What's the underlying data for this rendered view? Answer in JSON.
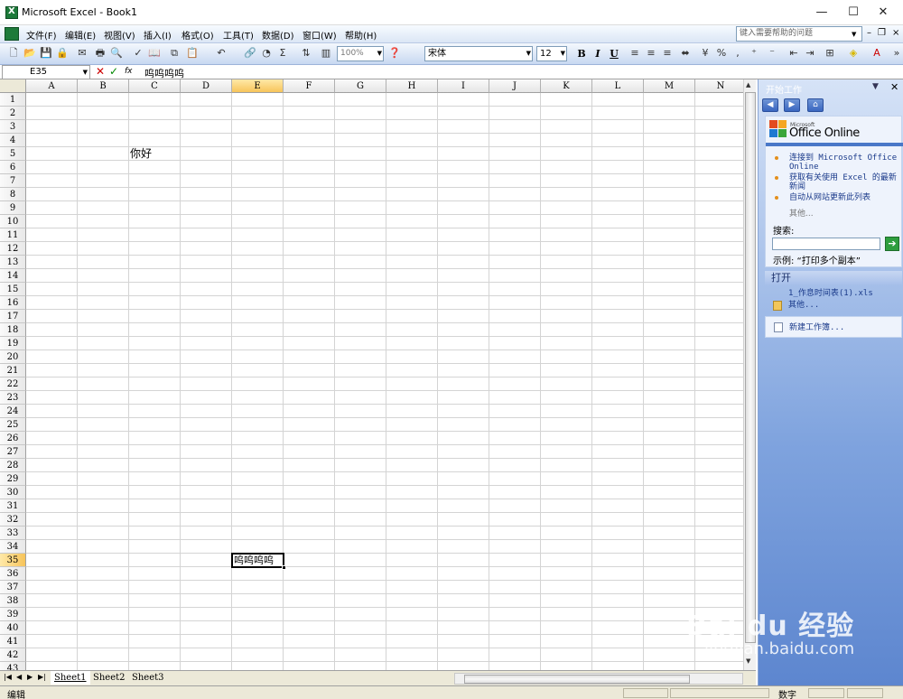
{
  "window": {
    "title": "Microsoft Excel - Book1",
    "minimize": "—",
    "maximize": "☐",
    "close": "✕"
  },
  "menubar": {
    "items": [
      "文件(F)",
      "编辑(E)",
      "视图(V)",
      "插入(I)",
      "格式(O)",
      "工具(T)",
      "数据(D)",
      "窗口(W)",
      "帮助(H)"
    ],
    "help_placeholder": "键入需要帮助的问题",
    "mdi_minimize": "–",
    "mdi_restore": "❐",
    "mdi_close": "×"
  },
  "toolbar": {
    "zoom": "100%",
    "font": "宋体",
    "font_size": "12",
    "bold": "B",
    "italic": "I",
    "underline": "U"
  },
  "formula_bar": {
    "name_box": "E35",
    "fx": "fx",
    "content": "呜呜呜呜"
  },
  "sheet": {
    "columns": [
      "A",
      "B",
      "C",
      "D",
      "E",
      "F",
      "G",
      "H",
      "I",
      "J",
      "K",
      "L",
      "M",
      "N"
    ],
    "active_column": "E",
    "rows": [
      "1",
      "2",
      "3",
      "4",
      "5",
      "6",
      "7",
      "8",
      "9",
      "10",
      "11",
      "12",
      "13",
      "14",
      "15",
      "16",
      "17",
      "18",
      "19",
      "20",
      "21",
      "22",
      "23",
      "24",
      "25",
      "26",
      "27",
      "28",
      "29",
      "30",
      "31",
      "32",
      "33",
      "34",
      "35",
      "36",
      "37",
      "38",
      "39",
      "40",
      "41",
      "42",
      "43"
    ],
    "active_row": "35",
    "cells": {
      "C5": "你好",
      "E35": "呜呜呜呜"
    }
  },
  "tabs": {
    "sheets": [
      "Sheet1",
      "Sheet2",
      "Sheet3"
    ],
    "active": "Sheet1"
  },
  "status": {
    "mode": "编辑",
    "num": "数字"
  },
  "taskpane": {
    "title": "开始工作",
    "office_small": "Microsoft",
    "office_big": "Office Online",
    "links": [
      "连接到 Microsoft Office Online",
      "获取有关使用 Excel 的最新新闻",
      "自动从网站更新此列表"
    ],
    "more": "其他...",
    "search_label": "搜索:",
    "example": "示例:  “打印多个副本”",
    "open_section": "打开",
    "recent_file": "1_作息时间表(1).xls",
    "open_more": "其他...",
    "new_workbook": "新建工作簿..."
  },
  "watermark": {
    "brand": "Bai du 经验",
    "url": "jingyan.baidu.com"
  },
  "colors": {
    "active_header": "#f7c45a",
    "taskpane_blue": "#5d86cf",
    "link": "#1a3a8a"
  }
}
